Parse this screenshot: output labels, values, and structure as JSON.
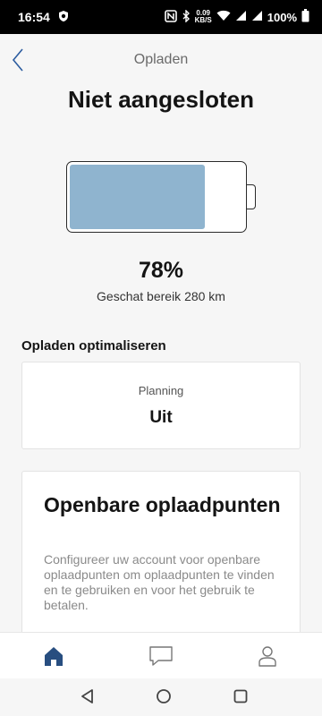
{
  "status_bar": {
    "time": "16:54",
    "speed_value": "0.09",
    "speed_unit": "KB/S",
    "battery": "100%"
  },
  "header": {
    "title": "Opladen",
    "back_icon": "chevron-left-icon"
  },
  "page_title": "Niet aangesloten",
  "battery": {
    "level": 0.78,
    "percent_text": "78%",
    "range_text": "Geschat bereik 280 km",
    "fill_color": "#8fb4cf"
  },
  "optimize": {
    "section_title": "Opladen optimaliseren",
    "planning_label": "Planning",
    "planning_value": "Uit"
  },
  "public_charging": {
    "title": "Openbare oplaadpunten",
    "description": "Configureer uw account voor openbare oplaadpunten om oplaadpunten te vinden en te gebruiken en voor het gebruik te betalen."
  },
  "bottom_nav": {
    "items": [
      {
        "icon": "home-icon",
        "active": true
      },
      {
        "icon": "chat-icon",
        "active": false
      },
      {
        "icon": "profile-icon",
        "active": false
      }
    ],
    "active_color": "#284e80"
  },
  "system_nav": [
    "back-triangle-icon",
    "home-circle-icon",
    "recents-square-icon"
  ]
}
